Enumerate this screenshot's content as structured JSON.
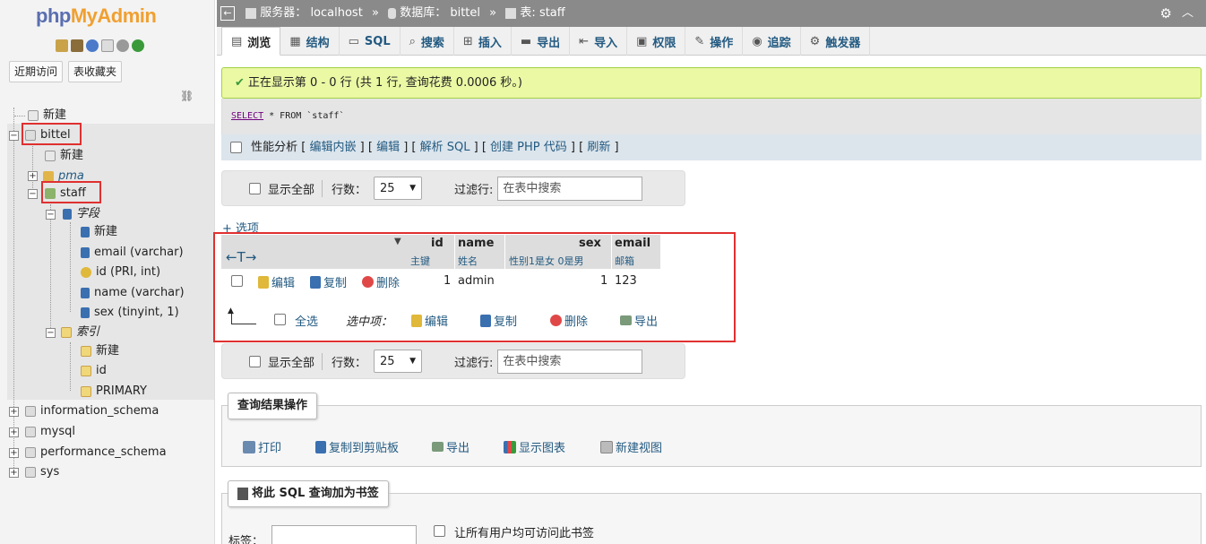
{
  "sidebar": {
    "logo_a": "php",
    "logo_b": "MyAdmin",
    "recent_btn": "近期访问",
    "fav_btn": "表收藏夹",
    "tree": [
      {
        "label": "新建"
      },
      {
        "label": "bittel"
      },
      {
        "label": "新建"
      },
      {
        "label": "pma"
      },
      {
        "label": "staff"
      },
      {
        "label": "字段"
      },
      {
        "label": "新建"
      },
      {
        "label": "email (varchar)"
      },
      {
        "label": "id (PRI, int)"
      },
      {
        "label": "name (varchar)"
      },
      {
        "label": "sex (tinyint, 1)"
      },
      {
        "label": "索引"
      },
      {
        "label": "新建"
      },
      {
        "label": "id"
      },
      {
        "label": "PRIMARY"
      },
      {
        "label": "information_schema"
      },
      {
        "label": "mysql"
      },
      {
        "label": "performance_schema"
      },
      {
        "label": "sys"
      }
    ]
  },
  "topbar": {
    "server_label": "服务器：",
    "server": "localhost",
    "db_label": "数据库：",
    "db": "bittel",
    "table_label": "表:",
    "table": "staff",
    "sep": "»"
  },
  "tabs": [
    "浏览",
    "结构",
    "SQL",
    "搜索",
    "插入",
    "导出",
    "导入",
    "权限",
    "操作",
    "追踪",
    "触发器"
  ],
  "success_msg": "正在显示第 0 - 0 行 (共 1 行, 查询花费 0.0006 秒。)",
  "sql": {
    "select": "SELECT",
    "rest": " * FROM `staff`"
  },
  "profiling": {
    "label": "性能分析",
    "links": [
      "编辑内嵌",
      "编辑",
      "解析 SQL",
      "创建 PHP 代码",
      "刷新"
    ]
  },
  "nav": {
    "show_all": "显示全部",
    "rows_label": "行数：",
    "rows_value": "25",
    "filter_label": "过滤行:",
    "filter_placeholder": "在表中搜索"
  },
  "options_link": "+ 选项",
  "table": {
    "arrows": "←T→",
    "columns": [
      {
        "name": "id",
        "comment": "主键"
      },
      {
        "name": "name",
        "comment": "姓名"
      },
      {
        "name": "sex",
        "comment": "性别1是女 0是男"
      },
      {
        "name": "email",
        "comment": "邮箱"
      }
    ],
    "row": {
      "edit": "编辑",
      "copy": "复制",
      "delete": "删除",
      "id": "1",
      "name": "admin",
      "sex": "1",
      "email": "123"
    },
    "footer": {
      "check_all": "全选",
      "with_selected": "选中项：",
      "edit": "编辑",
      "copy": "复制",
      "delete": "删除",
      "export": "导出"
    }
  },
  "query_ops": {
    "legend": "查询结果操作",
    "items": [
      "打印",
      "复制到剪贴板",
      "导出",
      "显示图表",
      "新建视图"
    ]
  },
  "bookmark": {
    "legend": "将此 SQL 查询加为书签",
    "label_field": "标签：",
    "public_label": "让所有用户均可访问此书签"
  },
  "colors": {
    "success_bg": "#ebf8a4",
    "highlight": "#e03030",
    "link": "#235a81"
  }
}
